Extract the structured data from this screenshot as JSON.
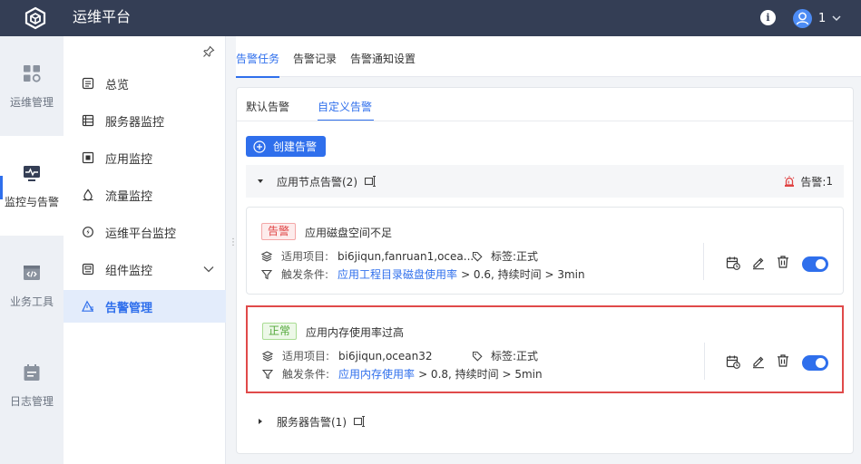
{
  "header": {
    "app_title": "运维平台",
    "user_name": "1",
    "info_icon": "info-icon",
    "info_glyph": "i"
  },
  "rail": {
    "items": [
      {
        "label": "运维管理",
        "icon": "dashboard-grid-icon"
      },
      {
        "label": "监控与告警",
        "icon": "monitor-pulse-icon"
      },
      {
        "label": "业务工具",
        "icon": "code-window-icon"
      },
      {
        "label": "日志管理",
        "icon": "calendar-log-icon"
      }
    ]
  },
  "sidebar": {
    "items": [
      {
        "label": "总览",
        "icon": "overview-icon"
      },
      {
        "label": "服务器监控",
        "icon": "server-list-icon"
      },
      {
        "label": "应用监控",
        "icon": "app-window-icon"
      },
      {
        "label": "流量监控",
        "icon": "traffic-drop-icon"
      },
      {
        "label": "运维平台监控",
        "icon": "platform-gear-icon"
      },
      {
        "label": "组件监控",
        "icon": "component-icon"
      },
      {
        "label": "告警管理",
        "icon": "alert-triangle-icon"
      }
    ]
  },
  "tabs": [
    "告警任务",
    "告警记录",
    "告警通知设置"
  ],
  "subtabs": [
    "默认告警",
    "自定义告警"
  ],
  "create_button": "创建告警",
  "groups": [
    {
      "title": "应用节点告警(2)",
      "alarm_label": "告警:",
      "alarm_count": "1"
    },
    {
      "title": "服务器告警(1)"
    }
  ],
  "rules": [
    {
      "status": "告警",
      "title": "应用磁盘空间不足",
      "projects_label": "适用项目:",
      "projects": "bi6jiqun,fanruan1,ocea...",
      "tag_label": "标签:正式",
      "condition_label": "触发条件:",
      "metric": "应用工程目录磁盘使用率",
      "condition": "> 0.6, 持续时间 > 3min",
      "enabled": true
    },
    {
      "status": "正常",
      "title": "应用内存使用率过高",
      "projects_label": "适用项目:",
      "projects": "bi6jiqun,ocean32",
      "tag_label": "标签:正式",
      "condition_label": "触发条件:",
      "metric": "应用内存使用率",
      "condition": "> 0.8, 持续时间 > 5min",
      "enabled": true
    }
  ],
  "colors": {
    "topbar": "#343e55",
    "accent": "#2f6fec",
    "alarm": "#e04444",
    "normal": "#53a83a",
    "highlight_border": "#e04a4a"
  }
}
